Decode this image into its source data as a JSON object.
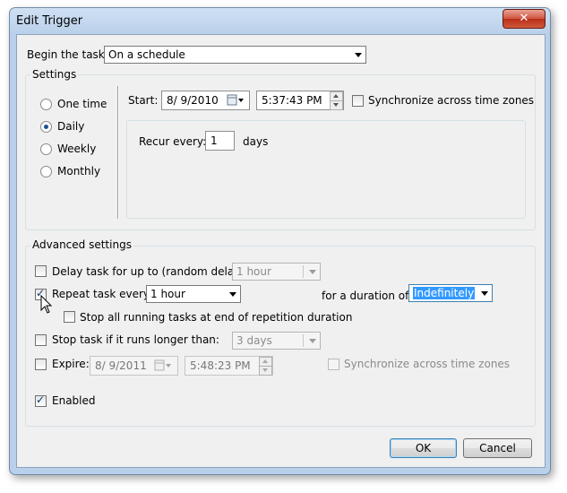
{
  "window": {
    "title": "Edit Trigger",
    "close_label": "✕"
  },
  "begin_task": {
    "label": "Begin the task:",
    "value": "On a schedule"
  },
  "settings": {
    "title": "Settings",
    "radios": [
      {
        "label": "One time",
        "checked": false
      },
      {
        "label": "Daily",
        "checked": true
      },
      {
        "label": "Weekly",
        "checked": false
      },
      {
        "label": "Monthly",
        "checked": false
      }
    ],
    "start_label": "Start:",
    "start_date": "8/  9/2010",
    "start_time": "5:37:43 PM",
    "sync_label": "Synchronize across time zones",
    "recur_label": "Recur every:",
    "recur_value": "1",
    "recur_unit": "days"
  },
  "advanced": {
    "title": "Advanced settings",
    "delay_label": "Delay task for up to (random delay):",
    "delay_value": "1 hour",
    "repeat_label": "Repeat task every:",
    "repeat_value": "1 hour",
    "duration_label": "for a duration of:",
    "duration_value": "Indefinitely",
    "stop_running_label": "Stop all running tasks at end of repetition duration",
    "stop_longer_label": "Stop task if it runs longer than:",
    "stop_longer_value": "3 days",
    "expire_label": "Expire:",
    "expire_date": "8/  9/2011",
    "expire_time": "5:48:23 PM",
    "expire_sync_label": "Synchronize across time zones",
    "enabled_label": "Enabled"
  },
  "buttons": {
    "ok": "OK",
    "cancel": "Cancel"
  }
}
